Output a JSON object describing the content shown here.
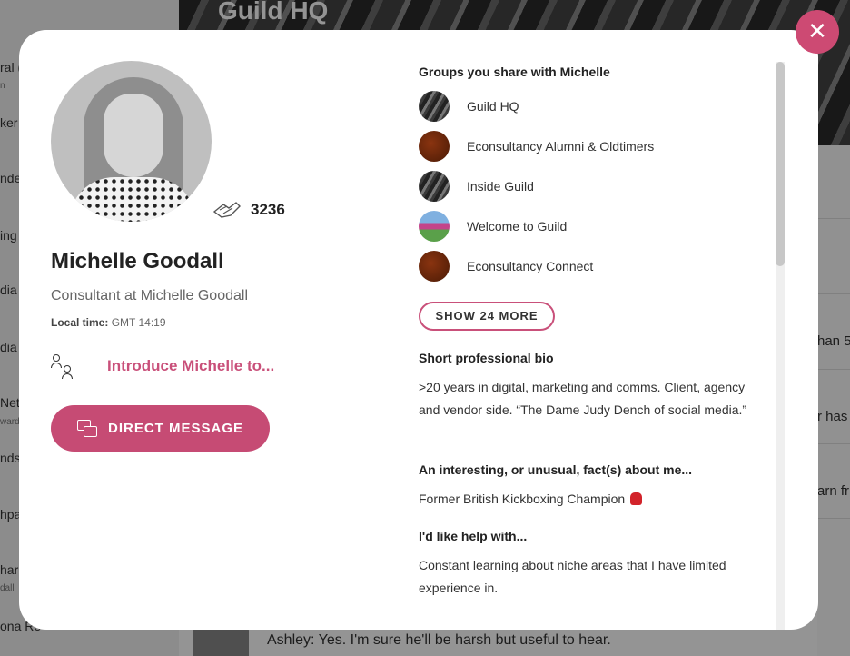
{
  "background": {
    "banner_title": "Guild HQ",
    "sidebar_fragments": [
      "ral (",
      "n",
      "ker",
      "nde",
      "ing",
      "dia",
      "dia",
      "Net",
      "ward",
      "nds",
      "hpa",
      "har",
      "dall",
      "ona Re"
    ],
    "right_fragments": [
      "han 5",
      "r has",
      "arn fr"
    ],
    "chat_preview": "Ashley: Yes. I'm sure he'll be harsh but useful to hear."
  },
  "profile": {
    "name": "Michelle Goodall",
    "title": "Consultant at Michelle Goodall",
    "local_time_label": "Local time:",
    "local_time_value": "GMT 14:19",
    "claps": "3236",
    "introduce_label": "Introduce Michelle to...",
    "dm_label": "DIRECT MESSAGE"
  },
  "groups": {
    "heading": "Groups you share with Michelle",
    "items": [
      {
        "name": "Guild HQ",
        "icon": "guild-hq-group-icon"
      },
      {
        "name": "Econsultancy Alumni & Oldtimers",
        "icon": "econsultancy-group-icon"
      },
      {
        "name": "Inside Guild",
        "icon": "inside-guild-group-icon"
      },
      {
        "name": "Welcome to Guild",
        "icon": "welcome-group-icon"
      },
      {
        "name": "Econsultancy Connect",
        "icon": "econsultancy-group-icon"
      }
    ],
    "show_more": "SHOW 24 MORE"
  },
  "bio": {
    "heading": "Short professional bio",
    "text": ">20 years in digital, marketing and comms. Client, agency and vendor side. “The Dame Judy Dench of social media.”"
  },
  "fact": {
    "heading": "An interesting, or unusual, fact(s) about me...",
    "text": "Former British Kickboxing Champion"
  },
  "help": {
    "heading": "I'd like help with...",
    "text": "Constant learning about niche areas that I have limited experience in."
  },
  "colors": {
    "accent": "#c64b74",
    "close_button": "#cd4a73"
  }
}
